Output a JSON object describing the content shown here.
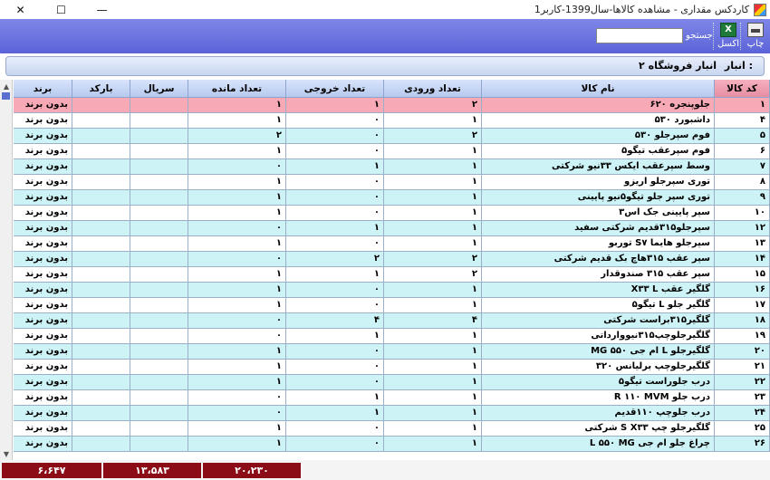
{
  "window": {
    "title": "کاردکس مقداری - مشاهده کالاها-سال1399-کاربر1",
    "minimize": "—",
    "maximize": "☐",
    "close": "✕"
  },
  "toolbar": {
    "print_label": "چاپ",
    "excel_label": "اکسل",
    "excel_glyph": "X",
    "search_label": "جستجو",
    "search_value": ""
  },
  "warehouse": {
    "label": "انبار :",
    "value": "۲ انبار فروشگاه"
  },
  "columns": {
    "code": "کد کالا",
    "name": "نام کالا",
    "in": "تعداد ورودی",
    "out": "تعداد خروجی",
    "remain": "تعداد مانده",
    "serial": "سریال",
    "barcode": "بارکد",
    "brand": "برند"
  },
  "rows": [
    {
      "code": "۱",
      "name": "جلوپنجره ۶۲۰",
      "in": "۲",
      "out": "۱",
      "remain": "۱",
      "serial": "",
      "barcode": "",
      "brand": "بدون برند"
    },
    {
      "code": "۴",
      "name": "داشبورد ۵۳۰",
      "in": "۱",
      "out": "۰",
      "remain": "۱",
      "serial": "",
      "barcode": "",
      "brand": "بدون برند"
    },
    {
      "code": "۵",
      "name": "فوم سپرجلو ۵۳۰",
      "in": "۲",
      "out": "۰",
      "remain": "۲",
      "serial": "",
      "barcode": "",
      "brand": "بدون برند"
    },
    {
      "code": "۶",
      "name": "فوم سپرعقب تیگو۵",
      "in": "۱",
      "out": "۰",
      "remain": "۱",
      "serial": "",
      "barcode": "",
      "brand": "بدون برند"
    },
    {
      "code": "۷",
      "name": "وسط سپرعقب ایکس ۳۳نیو شرکتی",
      "in": "۱",
      "out": "۱",
      "remain": "۰",
      "serial": "",
      "barcode": "",
      "brand": "بدون برند"
    },
    {
      "code": "۸",
      "name": "توری سپرجلو اریزو",
      "in": "۱",
      "out": "۰",
      "remain": "۱",
      "serial": "",
      "barcode": "",
      "brand": "بدون برند"
    },
    {
      "code": "۹",
      "name": "توری سپر جلو تیگو۵نیو پایینی",
      "in": "۱",
      "out": "۰",
      "remain": "۱",
      "serial": "",
      "barcode": "",
      "brand": "بدون برند"
    },
    {
      "code": "۱۰",
      "name": "سپر پایینی جک اس۳",
      "in": "۱",
      "out": "۰",
      "remain": "۱",
      "serial": "",
      "barcode": "",
      "brand": "بدون برند"
    },
    {
      "code": "۱۲",
      "name": "سپرجلو۳۱۵قدیم شرکتی سفید",
      "in": "۱",
      "out": "۱",
      "remain": "۰",
      "serial": "",
      "barcode": "",
      "brand": "بدون برند"
    },
    {
      "code": "۱۳",
      "name": "سپرجلو هایما S۷ توربو",
      "in": "۱",
      "out": "۰",
      "remain": "۱",
      "serial": "",
      "barcode": "",
      "brand": "بدون برند"
    },
    {
      "code": "۱۴",
      "name": "سپر عقب ۳۱۵هاچ بک قدیم شرکتی",
      "in": "۲",
      "out": "۲",
      "remain": "۰",
      "serial": "",
      "barcode": "",
      "brand": "بدون برند"
    },
    {
      "code": "۱۵",
      "name": "سپر عقب ۳۱۵ صندوقدار",
      "in": "۲",
      "out": "۱",
      "remain": "۱",
      "serial": "",
      "barcode": "",
      "brand": "بدون برند"
    },
    {
      "code": "۱۶",
      "name": "گلگیر عقب X۳۳ L",
      "in": "۱",
      "out": "۰",
      "remain": "۱",
      "serial": "",
      "barcode": "",
      "brand": "بدون برند"
    },
    {
      "code": "۱۷",
      "name": "گلگیر جلو L تیگو۵",
      "in": "۱",
      "out": "۰",
      "remain": "۱",
      "serial": "",
      "barcode": "",
      "brand": "بدون برند"
    },
    {
      "code": "۱۸",
      "name": "گلگیر۳۱۵براست شرکتی",
      "in": "۴",
      "out": "۴",
      "remain": "۰",
      "serial": "",
      "barcode": "",
      "brand": "بدون برند"
    },
    {
      "code": "۱۹",
      "name": "گلگیرجلوچپ۳۱۵نیووارداتی",
      "in": "۱",
      "out": "۱",
      "remain": "۰",
      "serial": "",
      "barcode": "",
      "brand": "بدون برند"
    },
    {
      "code": "۲۰",
      "name": "گلگیرجلو L ام جی ۵۵۰ MG",
      "in": "۱",
      "out": "۰",
      "remain": "۱",
      "serial": "",
      "barcode": "",
      "brand": "بدون برند"
    },
    {
      "code": "۲۱",
      "name": "گلگیرجلوچپ برلیانس ۳۲۰",
      "in": "۱",
      "out": "۰",
      "remain": "۱",
      "serial": "",
      "barcode": "",
      "brand": "بدون برند"
    },
    {
      "code": "۲۲",
      "name": "درب جلوراست تیگو۵",
      "in": "۱",
      "out": "۰",
      "remain": "۱",
      "serial": "",
      "barcode": "",
      "brand": "بدون برند"
    },
    {
      "code": "۲۳",
      "name": "درب جلو R ۱۱۰ MVM",
      "in": "۱",
      "out": "۱",
      "remain": "۰",
      "serial": "",
      "barcode": "",
      "brand": "بدون برند"
    },
    {
      "code": "۲۴",
      "name": "درب جلوچپ ۱۱۰قدیم",
      "in": "۱",
      "out": "۱",
      "remain": "۰",
      "serial": "",
      "barcode": "",
      "brand": "بدون برند"
    },
    {
      "code": "۲۵",
      "name": "گلگیرجلو چپ S X۳۳ شرکتی",
      "in": "۱",
      "out": "۰",
      "remain": "۱",
      "serial": "",
      "barcode": "",
      "brand": "بدون برند"
    },
    {
      "code": "۲۶",
      "name": "چراغ جلو ام جی L ۵۵۰ MG",
      "in": "۱",
      "out": "۰",
      "remain": "۱",
      "serial": "",
      "barcode": "",
      "brand": "بدون برند"
    }
  ],
  "totals": {
    "in": "۲۰،۲۳۰",
    "out": "۱۳،۵۸۳",
    "remain": "۶،۶۴۷"
  },
  "colors": {
    "row_selected": "#f8a9b6",
    "row_alt": "#cdf3f7",
    "row_plain": "#ffffff",
    "total_bg": "#8b0b16"
  }
}
